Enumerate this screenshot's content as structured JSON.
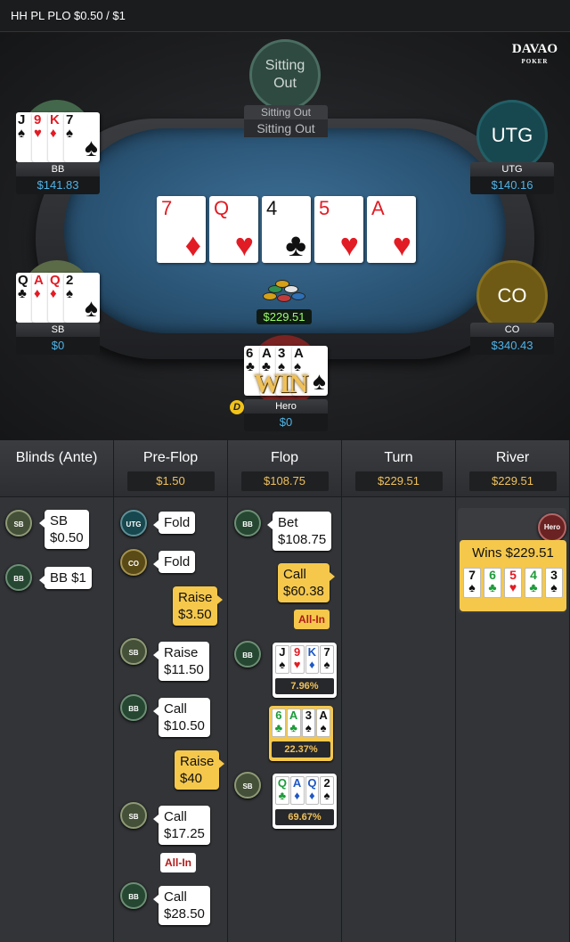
{
  "title": "HH PL PLO $0.50 / $1",
  "logo": {
    "brand": "DAVAO",
    "sub": "POKER"
  },
  "seats": {
    "top": {
      "circle": "Sitting Out",
      "name": "Sitting Out",
      "status": "Sitting Out"
    },
    "utg": {
      "circle": "UTG",
      "name": "UTG",
      "stack": "$140.16"
    },
    "co": {
      "circle": "CO",
      "name": "CO",
      "stack": "$340.43"
    },
    "bb": {
      "name": "BB",
      "stack": "$141.83",
      "cards": [
        [
          "J",
          "♠",
          "blk"
        ],
        [
          "9",
          "♥",
          "red"
        ],
        [
          "K",
          "♦",
          "red"
        ],
        [
          "7",
          "♠",
          "blk"
        ]
      ]
    },
    "sb": {
      "name": "SB",
      "stack": "$0",
      "cards": [
        [
          "Q",
          "♣",
          "blk"
        ],
        [
          "A",
          "♦",
          "red"
        ],
        [
          "Q",
          "♦",
          "red"
        ],
        [
          "2",
          "♠",
          "blk"
        ]
      ]
    },
    "hero": {
      "name": "Hero",
      "stack": "$0",
      "cards": [
        [
          "6",
          "♣",
          "blk"
        ],
        [
          "A",
          "♣",
          "blk"
        ],
        [
          "3",
          "♠",
          "blk"
        ],
        [
          "A",
          "♠",
          "blk"
        ]
      ],
      "win": "WIN",
      "dealer": "D"
    }
  },
  "board": [
    [
      "7",
      "♦",
      "red"
    ],
    [
      "Q",
      "♥",
      "red"
    ],
    [
      "4",
      "♣",
      "blk"
    ],
    [
      "5",
      "♥",
      "red"
    ],
    [
      "A",
      "♥",
      "red"
    ]
  ],
  "pot": "$229.51",
  "columns": [
    {
      "title": "Blinds (Ante)",
      "pot": ""
    },
    {
      "title": "Pre-Flop",
      "pot": "$1.50"
    },
    {
      "title": "Flop",
      "pot": "$108.75"
    },
    {
      "title": "Turn",
      "pot": "$229.51"
    },
    {
      "title": "River",
      "pot": "$229.51"
    }
  ],
  "actions": {
    "blinds": [
      {
        "badge": "SB",
        "line1": "SB",
        "line2": "$0.50"
      },
      {
        "badge": "BB",
        "line1": "BB $1"
      }
    ],
    "preflop": [
      {
        "badge": "UTG",
        "line1": "Fold"
      },
      {
        "badge": "CO",
        "line1": "Fold"
      },
      {
        "line1": "Raise",
        "line2": "$3.50"
      },
      {
        "badge": "SB",
        "line1": "Raise",
        "line2": "$11.50"
      },
      {
        "badge": "BB",
        "line1": "Call",
        "line2": "$10.50"
      },
      {
        "line1": "Raise",
        "line2": "$40"
      },
      {
        "badge": "SB",
        "line1": "Call",
        "line2": "$17.25",
        "allin": "All-In"
      },
      {
        "badge": "BB",
        "line1": "Call",
        "line2": "$28.50"
      }
    ],
    "flop": [
      {
        "badge": "BB",
        "line1": "Bet",
        "line2": "$108.75"
      },
      {
        "line1": "Call",
        "line2": "$60.38",
        "allin": "All-In"
      }
    ],
    "showdown": [
      {
        "badge": "BB",
        "cards": [
          [
            "J",
            "♠",
            "blk"
          ],
          [
            "9",
            "♥",
            "red"
          ],
          [
            "K",
            "♦",
            "blu"
          ],
          [
            "7",
            "♠",
            "blk"
          ]
        ],
        "pct": "7.96%"
      },
      {
        "cards": [
          [
            "6",
            "♣",
            "grn"
          ],
          [
            "A",
            "♣",
            "grn"
          ],
          [
            "3",
            "♠",
            "blk"
          ],
          [
            "A",
            "♠",
            "blk"
          ]
        ],
        "pct": "22.37%"
      },
      {
        "badge": "SB",
        "cards": [
          [
            "Q",
            "♣",
            "grn"
          ],
          [
            "A",
            "♦",
            "blu"
          ],
          [
            "Q",
            "♦",
            "blu"
          ],
          [
            "2",
            "♠",
            "blk"
          ]
        ],
        "pct": "69.67%"
      }
    ],
    "river": {
      "badge": "Hero",
      "text": "Wins $229.51",
      "cards": [
        [
          "7",
          "♠",
          "blk"
        ],
        [
          "6",
          "♣",
          "grn"
        ],
        [
          "5",
          "♥",
          "red"
        ],
        [
          "4",
          "♣",
          "grn"
        ],
        [
          "3",
          "♠",
          "blk"
        ]
      ]
    }
  }
}
